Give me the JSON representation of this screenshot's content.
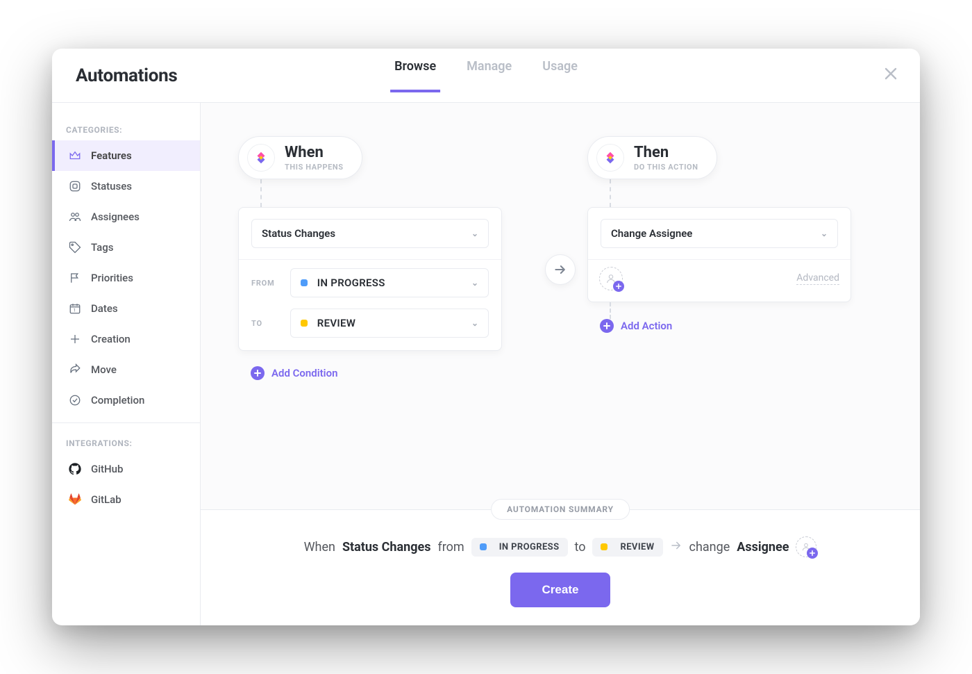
{
  "header": {
    "title": "Automations",
    "tabs": {
      "browse": "Browse",
      "manage": "Manage",
      "usage": "Usage"
    }
  },
  "sidebar": {
    "categories_label": "CATEGORIES:",
    "integrations_label": "INTEGRATIONS:",
    "items": [
      {
        "label": "Features"
      },
      {
        "label": "Statuses"
      },
      {
        "label": "Assignees"
      },
      {
        "label": "Tags"
      },
      {
        "label": "Priorities"
      },
      {
        "label": "Dates"
      },
      {
        "label": "Creation"
      },
      {
        "label": "Move"
      },
      {
        "label": "Completion"
      }
    ],
    "integrations": [
      {
        "label": "GitHub"
      },
      {
        "label": "GitLab"
      }
    ]
  },
  "when": {
    "title": "When",
    "subtitle": "THIS HAPPENS",
    "trigger": "Status Changes",
    "from_label": "FROM",
    "to_label": "TO",
    "from_value": "IN PROGRESS",
    "from_color": "#4f9cf9",
    "to_value": "REVIEW",
    "to_color": "#ffc800",
    "add_condition": "Add Condition"
  },
  "then": {
    "title": "Then",
    "subtitle": "DO THIS ACTION",
    "action": "Change Assignee",
    "advanced": "Advanced",
    "add_action": "Add Action"
  },
  "summary": {
    "pill": "AUTOMATION SUMMARY",
    "when_word": "When",
    "trigger": "Status Changes",
    "from_word": "from",
    "from_value": "IN PROGRESS",
    "to_word": "to",
    "to_value": "REVIEW",
    "change_word": "change",
    "assignee_word": "Assignee",
    "create": "Create"
  },
  "colors": {
    "accent": "#7b68ee"
  }
}
